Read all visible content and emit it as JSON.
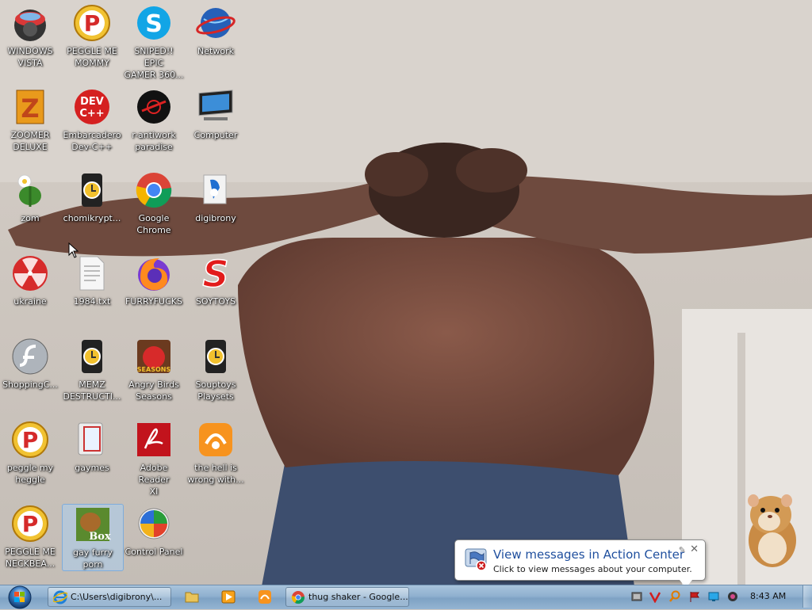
{
  "desktop": {
    "icons": [
      {
        "label": "WINDOWS\nVISTA",
        "icon": "vista-orb-icon"
      },
      {
        "label": "PEGGLE ME\nMOMMY",
        "icon": "peggle-icon"
      },
      {
        "label": "SNIPED!! EPIC\nGAMER 360...",
        "icon": "skype-icon"
      },
      {
        "label": "Network",
        "icon": "network-globe-icon"
      },
      {
        "label": "ZOOMER\nDELUXE",
        "icon": "zuma-icon"
      },
      {
        "label": "Embarcadero\nDev-C++",
        "icon": "devcpp-icon"
      },
      {
        "label": "r-antiwork\nparadise",
        "icon": "antiwork-icon"
      },
      {
        "label": "Computer",
        "icon": "computer-icon"
      },
      {
        "label": "zom",
        "icon": "plant-icon"
      },
      {
        "label": "chomikrypt...",
        "icon": "shortcut-clock-icon"
      },
      {
        "label": "Google\nChrome",
        "icon": "chrome-icon"
      },
      {
        "label": "digibrony",
        "icon": "user-folder-icon"
      },
      {
        "label": "ukraine",
        "icon": "radiation-icon"
      },
      {
        "label": "1984.txt",
        "icon": "text-file-icon"
      },
      {
        "label": "FURRYFUCKS",
        "icon": "firefox-icon"
      },
      {
        "label": "SOYTOYS",
        "icon": "s-logo-icon"
      },
      {
        "label": "ShoppingC...",
        "icon": "flash-icon"
      },
      {
        "label": "MEMZ\nDESTRUCTI...",
        "icon": "shortcut-clock-icon"
      },
      {
        "label": "Angry Birds\nSeasons",
        "icon": "angry-birds-icon"
      },
      {
        "label": "Souptoys\nPlaysets",
        "icon": "shortcut-clock-icon"
      },
      {
        "label": "peggle my\nheggle",
        "icon": "peggle-icon"
      },
      {
        "label": "gaymes",
        "icon": "games-folder-icon"
      },
      {
        "label": "Adobe Reader\nXI",
        "icon": "adobe-reader-icon"
      },
      {
        "label": "the hell is\nwrong with...",
        "icon": "uc-browser-icon"
      },
      {
        "label": "PEGGLE ME\nNECKBEA...",
        "icon": "peggle-icon"
      },
      {
        "label": "gay furry\nporn",
        "icon": "bonzi-box-icon"
      },
      {
        "label": "Control Panel",
        "icon": "control-panel-icon"
      }
    ]
  },
  "notification": {
    "title": "View messages in Action Center",
    "text": "Click to view messages about your computer.",
    "icon": "action-center-flag-icon"
  },
  "taskbar": {
    "start_icon": "windows-start-orb-icon",
    "tasks": [
      {
        "label": "C:\\Users\\digibrony\\...",
        "icon": "ie-icon"
      },
      {
        "label": "thug shaker - Google...",
        "icon": "chrome-icon"
      }
    ],
    "quick_launch": [
      "explorer-folder-icon",
      "media-player-icon",
      "uc-browser-icon"
    ],
    "tray_icons": [
      "device-icon",
      "v-logo-icon",
      "search-icon",
      "action-center-flag-icon",
      "display-icon",
      "speaker-icon"
    ],
    "clock": "8:43 AM"
  },
  "colors": {
    "taskbar": "#8fb0cf",
    "balloon_title": "#1f4f9e"
  }
}
